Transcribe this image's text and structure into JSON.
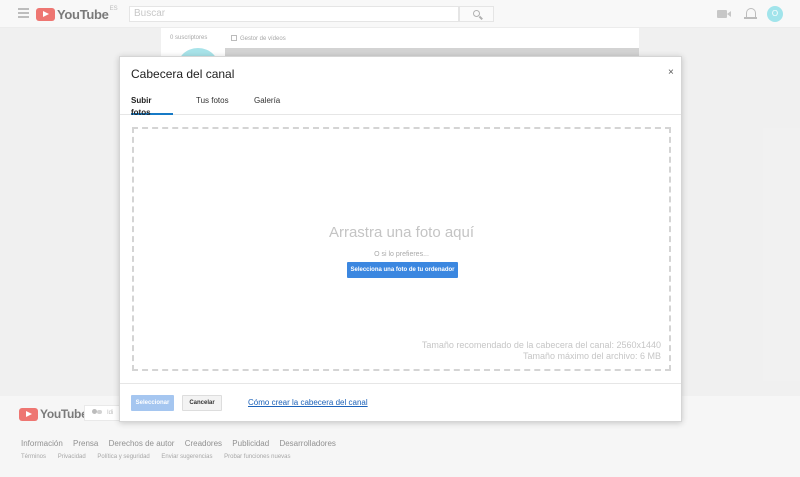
{
  "header": {
    "logo_text": "YouTube",
    "region": "ES",
    "search_placeholder": "Buscar",
    "avatar_letter": "O"
  },
  "channel": {
    "subscribers": "0 suscriptores",
    "video_manager": "Gestor de vídeos"
  },
  "modal": {
    "title": "Cabecera del canal",
    "close": "×",
    "tabs": [
      {
        "label": "Subir fotos",
        "active": true
      },
      {
        "label": "Tus fotos",
        "active": false
      },
      {
        "label": "Galería",
        "active": false
      }
    ],
    "drop_title": "Arrastra una foto aquí",
    "drop_or": "O si lo prefieres...",
    "select_button": "Selecciona una foto de tu ordenador",
    "recommended_size": "Tamaño recomendado de la cabecera del canal: 2560x1440",
    "max_size": "Tamaño máximo del archivo: 6 MB",
    "choose_button": "Seleccionar",
    "cancel_button": "Cancelar",
    "help_link": "Cómo crear la cabecera del canal"
  },
  "footer": {
    "logo_text": "YouTube",
    "language_button": "Idi",
    "links": [
      "Información",
      "Prensa",
      "Derechos de autor",
      "Creadores",
      "Publicidad",
      "Desarrolladores"
    ],
    "secondary_links": [
      "Términos",
      "Privacidad",
      "Política y seguridad",
      "Enviar sugerencias",
      "Probar funciones nuevas"
    ]
  },
  "colors": {
    "accent_blue": "#3b87e0",
    "tab_underline": "#167ac6",
    "brand_red": "#e52d27"
  }
}
